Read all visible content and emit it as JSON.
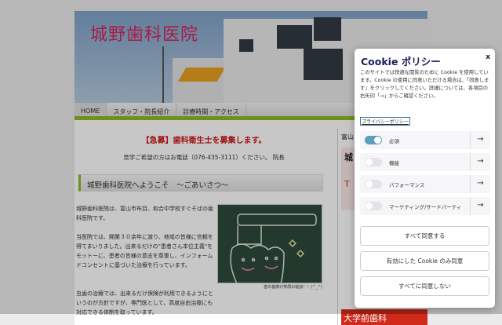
{
  "site": {
    "title": "城野歯科医院",
    "nav": [
      "HOME",
      "スタッフ・院長紹介",
      "診療時間・アクセス"
    ]
  },
  "main": {
    "alert": "【急募】歯科衛生士を募集します。",
    "visit": "見学ご希望の方はお電話（076-435-3111）ください。 院長",
    "greeting": "城野歯科医院へようこそ　～ごあいさつ～",
    "paragraphs": [
      "城野歯科医院は、富山市布目、和合中学校すぐそばの歯科医院です。",
      "当医院では、開業３０余年に渡り、地域の皆様に信頼を得てまいりました。出来るだけの\"患者さん本位主義\"をモットーに、患者の皆様の意志を尊重し、インフォームドコンセントに基づいた治療を行っています。",
      "虫歯の治療では、出来るだけ保険が利用できるようにというのが方針ですが、専門医として、高度自由治療にも対応できる体制を取っています。"
    ],
    "caption": "歯の健康が笑顔の秘訣！！(^_^)"
  },
  "sidebar": {
    "heading": "富山",
    "name": "城",
    "sub": "T",
    "banner": "大学前歯科"
  },
  "cookie": {
    "title": "Cookie ポリシー",
    "close": "x",
    "description": "このサイトでは快適な閲覧のために Cookie を使用しています。Cookie の使用に同意いただける場合は、「同意します」をクリックしてください。詳細については、各項目の右矢印「→」からご確認ください。",
    "privacy_link": "プライバシーポリシー",
    "categories": [
      {
        "label": "必須",
        "enabled": true
      },
      {
        "label": "機能",
        "enabled": false
      },
      {
        "label": "パフォーマンス",
        "enabled": false
      },
      {
        "label": "マーケティング/サードパーティ",
        "enabled": false
      }
    ],
    "arrow": "→",
    "buttons": [
      "すべて同意する",
      "有効にした Cookie のみ同意",
      "すべてに同意しない"
    ]
  }
}
